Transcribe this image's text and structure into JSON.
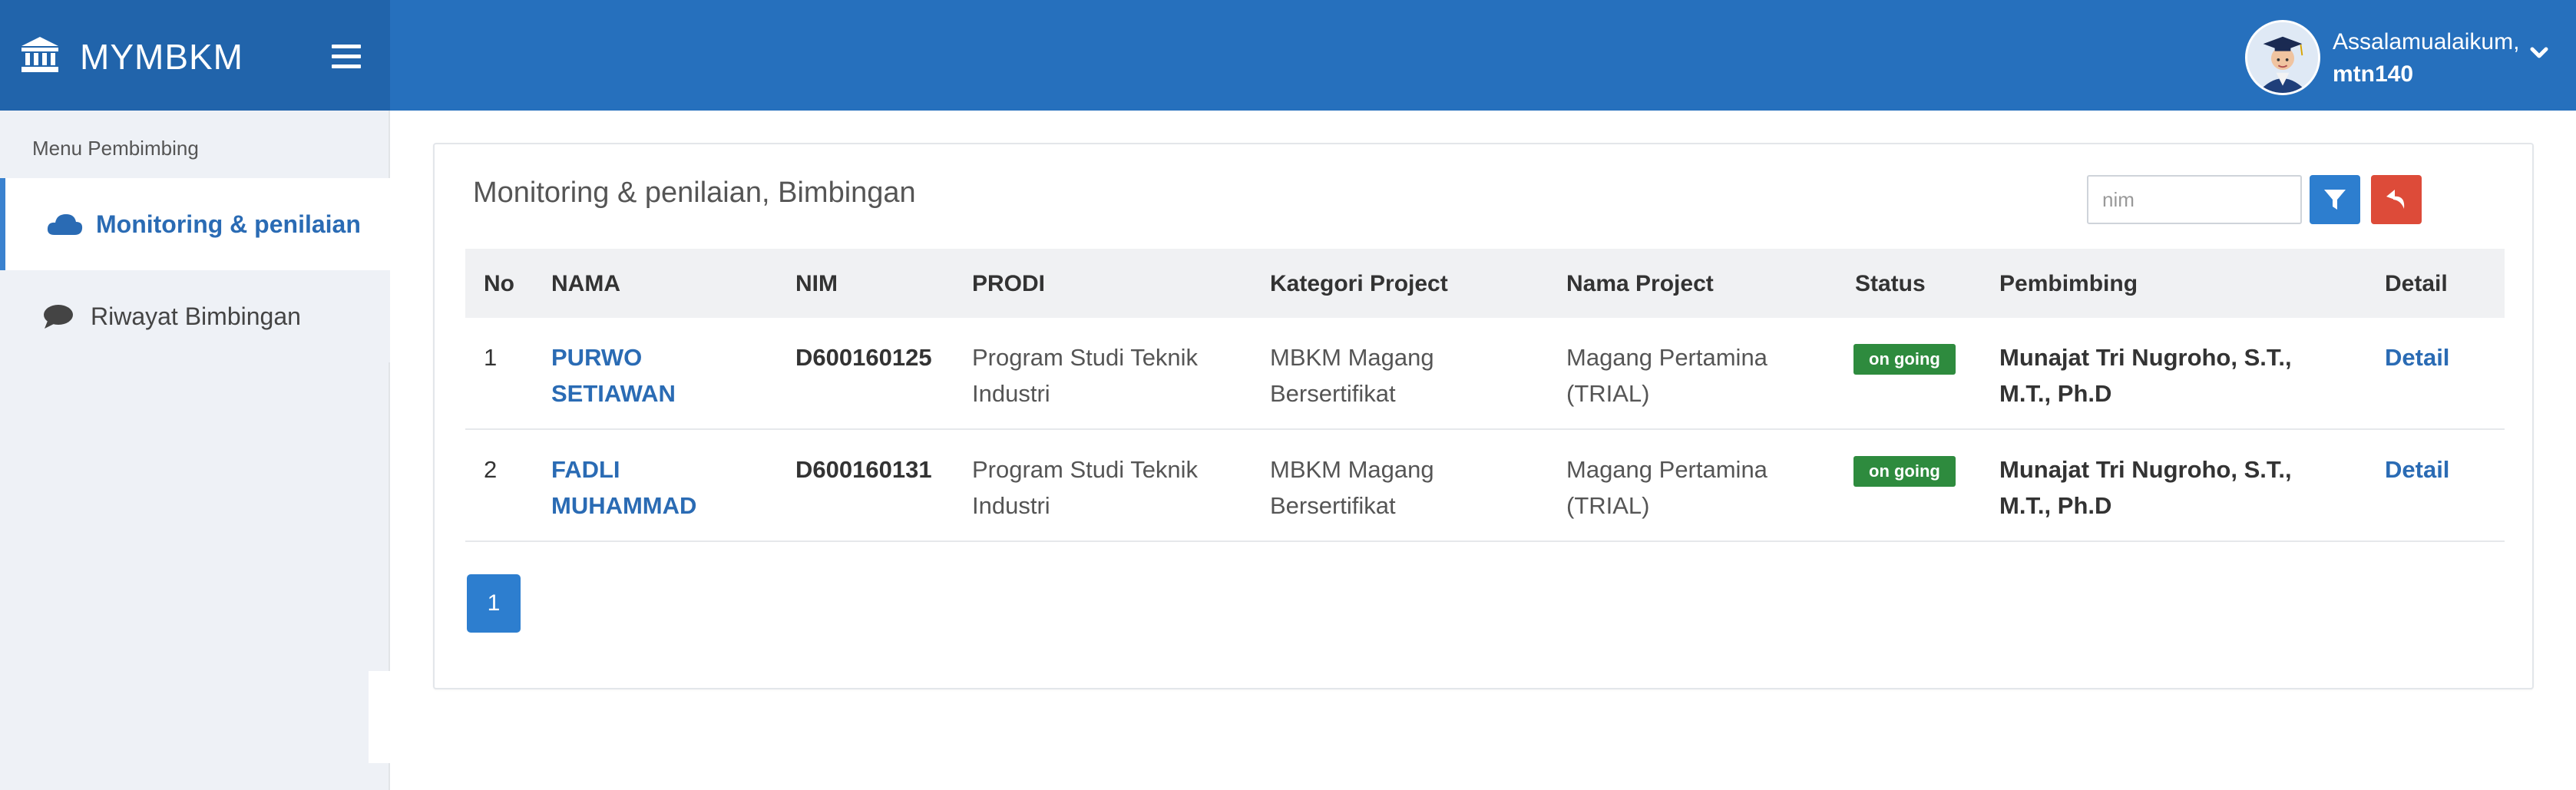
{
  "brand": {
    "name": "MYMBKM",
    "icon": "bank-icon"
  },
  "user": {
    "greeting": "Assalamualaikum,",
    "username": "mtn140"
  },
  "sidebar": {
    "header": "Menu Pembimbing",
    "items": [
      {
        "label": "Monitoring & penilaian",
        "icon": "cloud-icon",
        "active": true
      },
      {
        "label": "Riwayat Bimbingan",
        "icon": "comment-icon",
        "active": false
      }
    ]
  },
  "panel": {
    "title": "Monitoring & penilaian, Bimbingan",
    "search_placeholder": "nim",
    "search_value": ""
  },
  "table": {
    "headers": [
      "No",
      "NAMA",
      "NIM",
      "PRODI",
      "Kategori Project",
      "Nama Project",
      "Status",
      "Pembimbing",
      "Detail"
    ],
    "rows": [
      {
        "no": "1",
        "nama_line1": "PURWO",
        "nama_line2": "SETIAWAN",
        "nim": "D600160125",
        "prodi_line1": "Program Studi Teknik",
        "prodi_line2": "Industri",
        "kategori_line1": "MBKM Magang",
        "kategori_line2": "Bersertifikat",
        "project_line1": "Magang Pertamina",
        "project_line2": "(TRIAL)",
        "status": "on going",
        "pembimbing_line1": "Munajat Tri Nugroho, S.T.,",
        "pembimbing_line2": "M.T., Ph.D",
        "detail": "Detail"
      },
      {
        "no": "2",
        "nama_line1": "FADLI",
        "nama_line2": "MUHAMMAD",
        "nim": "D600160131",
        "prodi_line1": "Program Studi Teknik",
        "prodi_line2": "Industri",
        "kategori_line1": "MBKM Magang",
        "kategori_line2": "Bersertifikat",
        "project_line1": "Magang Pertamina",
        "project_line2": "(TRIAL)",
        "status": "on going",
        "pembimbing_line1": "Munajat Tri Nugroho, S.T.,",
        "pembimbing_line2": "M.T., Ph.D",
        "detail": "Detail"
      }
    ]
  },
  "pagination": {
    "current": "1"
  },
  "colors": {
    "header": "#2670bd",
    "brand_bg": "#2164ab",
    "primary": "#2d7ecf",
    "danger": "#dd4b39",
    "success": "#2e8b3e",
    "link": "#2a6bb4"
  }
}
